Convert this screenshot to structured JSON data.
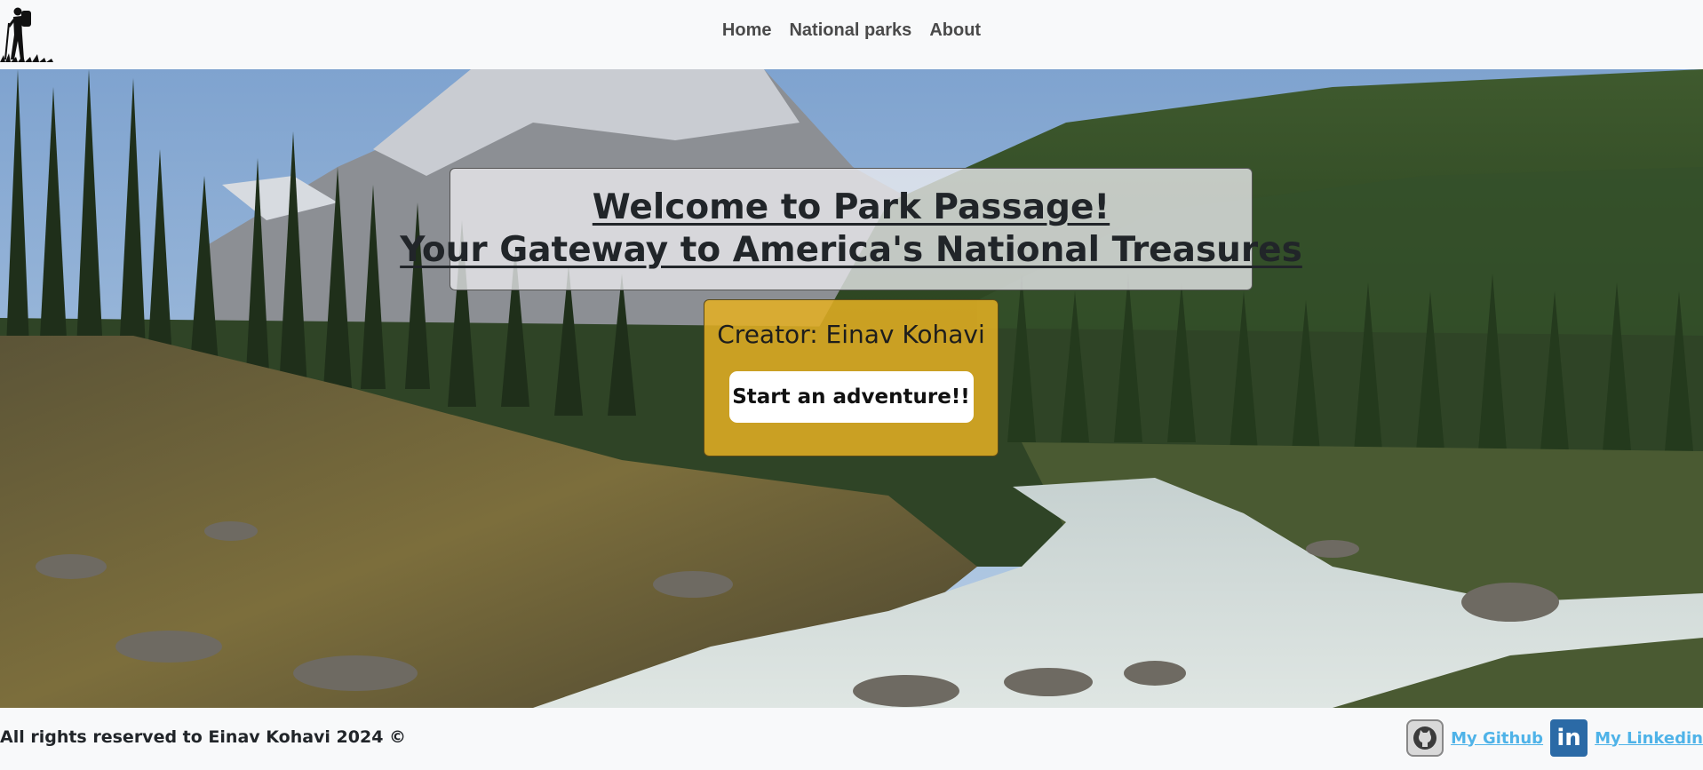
{
  "nav": {
    "items": [
      {
        "label": "Home"
      },
      {
        "label": "National parks"
      },
      {
        "label": "About"
      }
    ]
  },
  "hero": {
    "title_line1": "Welcome to Park Passage!",
    "title_line2": "Your Gateway to America's National Treasures",
    "creator": "Creator: Einav Kohavi",
    "cta_label": "Start an adventure!!"
  },
  "footer": {
    "copyright": "All rights reserved to Einav Kohavi 2024 ©",
    "github_label": "My Github",
    "linkedin_label": "My Linkedin",
    "linkedin_glyph": "in"
  },
  "colors": {
    "creator_box": "#e4b023",
    "link": "#4fb3e8",
    "linkedin_brand": "#2b6aa6"
  },
  "icons": {
    "logo": "hiker-silhouette-icon",
    "github": "github-icon",
    "linkedin": "linkedin-icon"
  }
}
